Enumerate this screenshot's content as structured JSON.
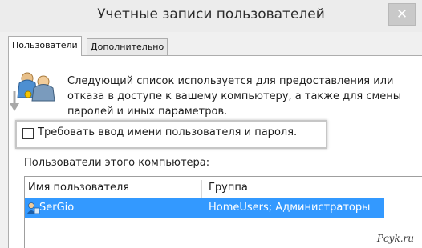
{
  "window": {
    "title": "Учетные записи пользователей",
    "close_glyph": "✕"
  },
  "tabs": [
    {
      "label": "Пользователи",
      "active": true
    },
    {
      "label": "Дополнительно",
      "active": false
    }
  ],
  "description": "Следующий список используется для предоставления или отказа в доступе к вашему компьютеру, а также для смены паролей и иных параметров.",
  "require_login": {
    "label": "Требовать ввод имени пользователя и пароля.",
    "checked": false
  },
  "users_section": {
    "label": "Пользователи этого компьютера:",
    "columns": [
      "Имя пользователя",
      "Группа"
    ],
    "rows": [
      {
        "name": "SerGio",
        "group": "HomeUsers; Администраторы",
        "selected": true
      }
    ]
  },
  "watermark": "Pcyk.ru",
  "icons": {
    "users": "users-icon",
    "arrow": "arrow-down-icon",
    "user_row": "user-icon"
  },
  "colors": {
    "selection": "#3399ff"
  }
}
